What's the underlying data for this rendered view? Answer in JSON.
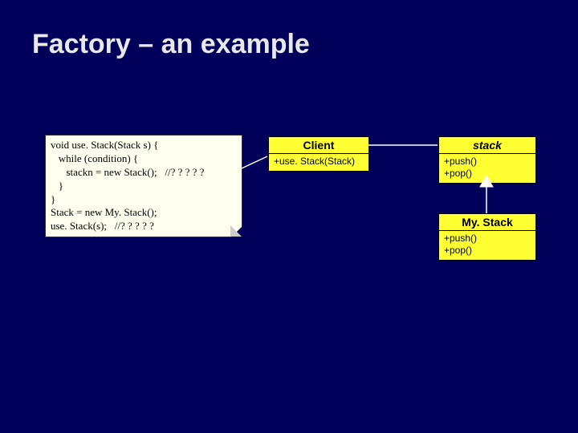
{
  "title": "Factory – an example",
  "note": {
    "code": "void use. Stack(Stack s) {\n   while (condition) {\n      stackn = new Stack();   //? ? ? ? ?\n   }\n}\nStack = new My. Stack();\nuse. Stack(s);   //? ? ? ? ?"
  },
  "uml": {
    "client": {
      "name": "Client",
      "members": [
        "+use. Stack(Stack)"
      ]
    },
    "stack": {
      "name": "stack",
      "members": [
        "+push()",
        "+pop()"
      ]
    },
    "mystack": {
      "name": "My. Stack",
      "members": [
        "+push()",
        "+pop()"
      ]
    }
  }
}
